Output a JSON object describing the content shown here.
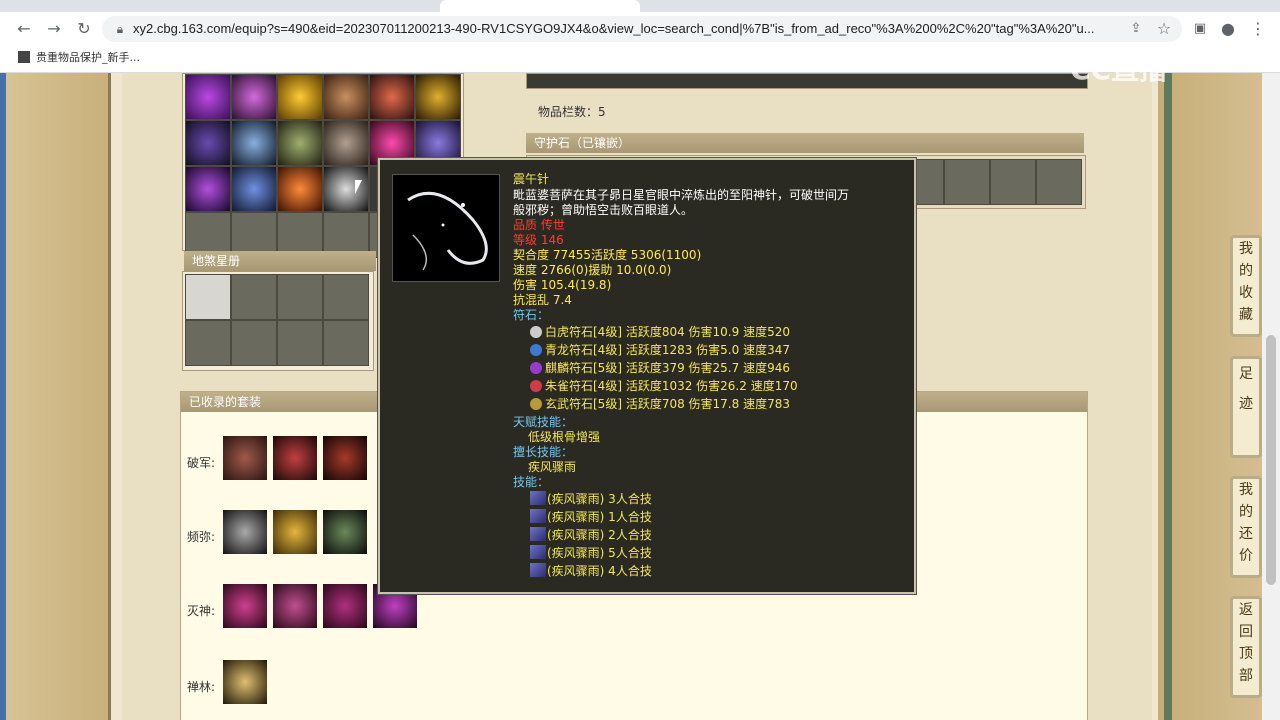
{
  "browser": {
    "tabs": [
      "",
      "",
      "",
      "",
      ""
    ],
    "url": "xy2.cbg.163.com/equip?s=490&eid=202307011200213-490-RV1CSYGO9JX4&o&view_loc=search_cond|%7B\"is_from_ad_reco\"%3A%200%2C%20\"tag\"%3A%20\"u...",
    "bookmark": "贵重物品保护_新手..."
  },
  "page": {
    "item_count_label": "物品栏数：5",
    "guard_stone_header": "守护石（已镶嵌）",
    "star_book_header": "地煞星册",
    "collected_sets_header": "已收录的套装",
    "set_labels": [
      "破军:",
      "频弥:",
      "灭神:",
      "禅林:"
    ]
  },
  "tooltip": {
    "name": "震午针",
    "desc1": "毗蓝婆菩萨在其子昴日星官眼中淬炼出的至阳神针，可破世间万",
    "desc2": "般邪秽；曾助悟空击败百眼道人。",
    "quality": "品质 传世",
    "level": "等级 146",
    "affinity": "契合度     77455活跃度  5306(1100)",
    "speed": "速度     2766(0)援助     10.0(0.0)",
    "damage": "伤害  105.4(19.8)",
    "resist": "抗混乱 7.4",
    "runes_label": "符石：",
    "runes": [
      "白虎符石[4级] 活跃度804 伤害10.9 速度520",
      "青龙符石[4级] 活跃度1283 伤害5.0 速度347",
      "麒麟符石[5级] 活跃度379 伤害25.7 速度946",
      "朱雀符石[4级] 活跃度1032 伤害26.2 速度170",
      "玄武符石[5级] 活跃度708 伤害17.8 速度783"
    ],
    "talent_label": "天赋技能：",
    "talent": "低级根骨增强",
    "expert_label": "擅长技能：",
    "expert": "疾风骤雨",
    "skill_label": "技能：",
    "skills": [
      "(疾风骤雨) 3人合技",
      "(疾风骤雨) 1人合技",
      "(疾风骤雨) 2人合技",
      "(疾风骤雨) 5人合技",
      "(疾风骤雨) 4人合技"
    ]
  },
  "side_buttons": [
    "我的收藏",
    "足迹",
    "我的还价",
    "返回顶部"
  ],
  "watermark": "CC直播"
}
